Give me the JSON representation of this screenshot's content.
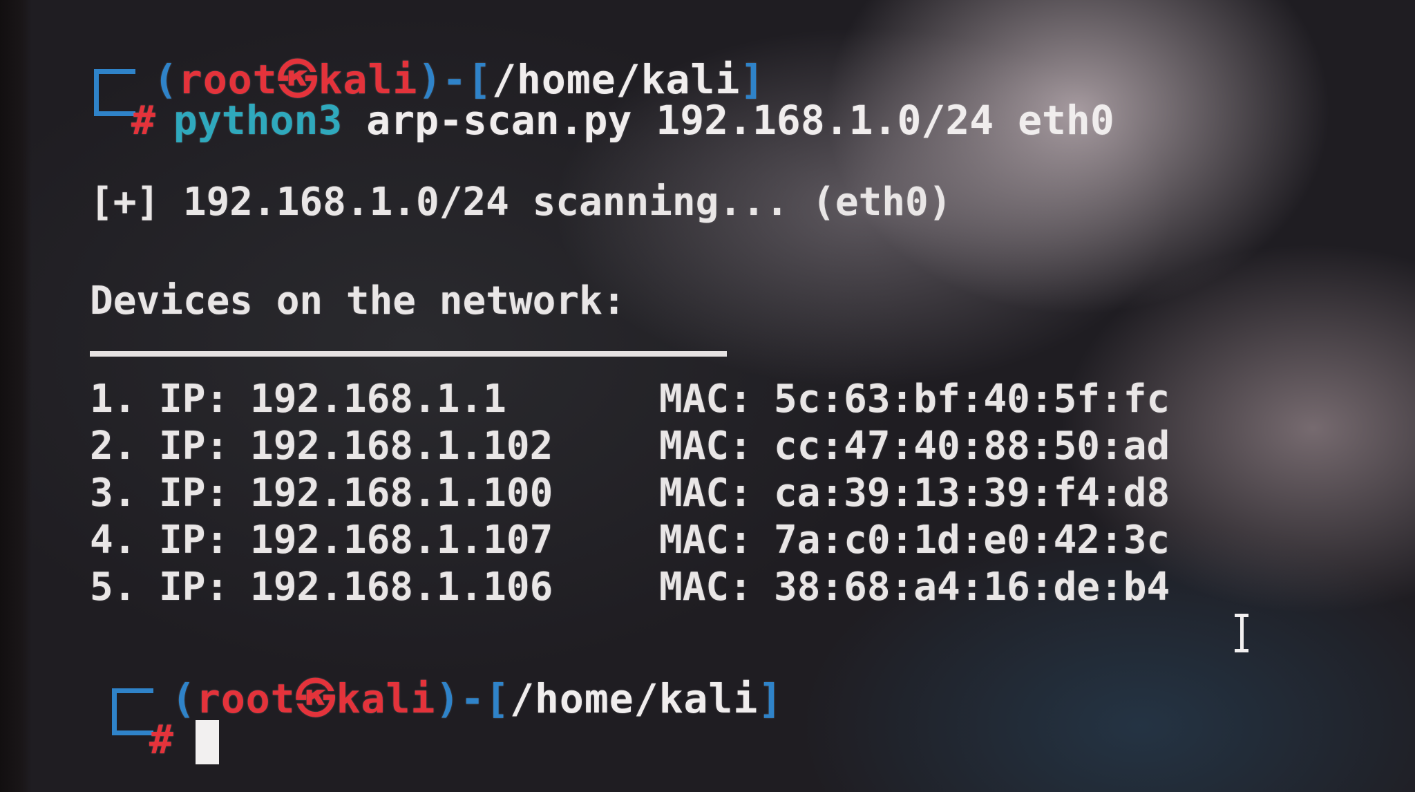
{
  "prompt": {
    "open_paren": "(",
    "user": "root",
    "skull_icon": "kali-skull-icon",
    "host": "kali",
    "close_paren_dash": ")-[",
    "cwd": "/home/kali",
    "close_bracket": "]",
    "symbol": "#"
  },
  "command": {
    "program": "python3",
    "script": "arp-scan.py",
    "args": "192.168.1.0/24 eth0"
  },
  "output": {
    "scan_line": "[+] 192.168.1.0/24 scanning... (eth0)",
    "devices_header": "Devices on the network:",
    "ip_label": "IP:",
    "mac_label": "MAC:",
    "devices": [
      {
        "num": "1.",
        "ip": "192.168.1.1",
        "mac": "5c:63:bf:40:5f:fc"
      },
      {
        "num": "2.",
        "ip": "192.168.1.102",
        "mac": "cc:47:40:88:50:ad"
      },
      {
        "num": "3.",
        "ip": "192.168.1.100",
        "mac": "ca:39:13:39:f4:d8"
      },
      {
        "num": "4.",
        "ip": "192.168.1.107",
        "mac": "7a:c0:1d:e0:42:3c"
      },
      {
        "num": "5.",
        "ip": "192.168.1.106",
        "mac": "38:68:a4:16:de:b4"
      }
    ]
  },
  "colors": {
    "prompt_frame": "#2f83c9",
    "user_host": "#e4333b",
    "command": "#2fa9bd",
    "text": "#e9e6e6"
  },
  "cursor_icon": "text-cursor-ibeam-icon"
}
